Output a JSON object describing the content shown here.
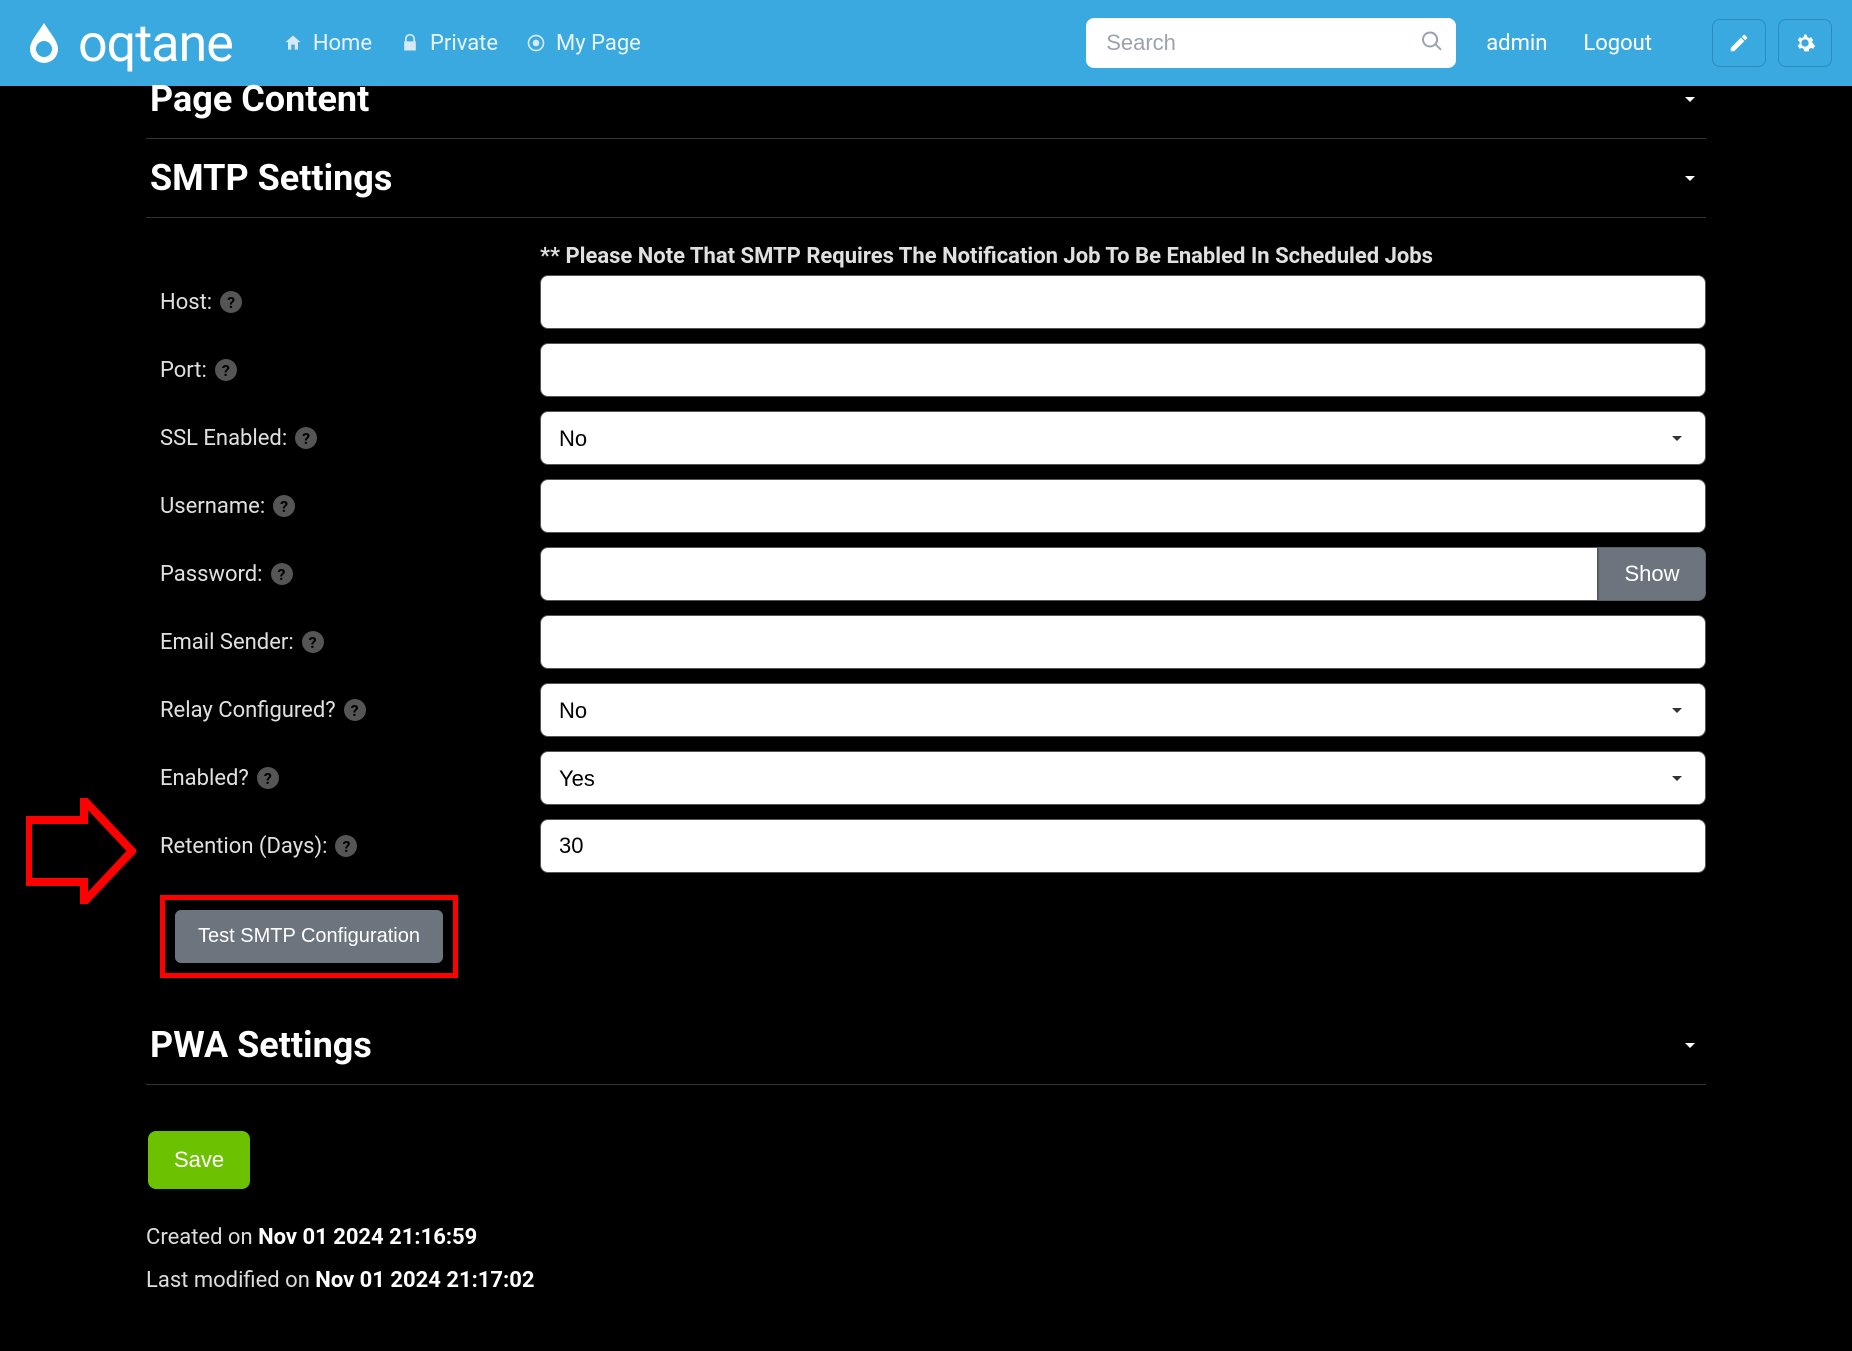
{
  "header": {
    "logo_text": "oqtane",
    "nav": [
      {
        "label": "Home",
        "icon": "home"
      },
      {
        "label": "Private",
        "icon": "lock"
      },
      {
        "label": "My Page",
        "icon": "target"
      }
    ],
    "search_placeholder": "Search",
    "user_link": "admin",
    "logout_link": "Logout"
  },
  "sections": {
    "page_content_title": "Page Content",
    "smtp_title": "SMTP Settings",
    "smtp_note": "** Please Note That SMTP Requires The Notification Job To Be Enabled In Scheduled Jobs",
    "pwa_title": "PWA Settings"
  },
  "smtp": {
    "host_label": "Host:",
    "host_value": "",
    "port_label": "Port:",
    "port_value": "",
    "ssl_label": "SSL Enabled:",
    "ssl_value": "No",
    "username_label": "Username:",
    "username_value": "",
    "password_label": "Password:",
    "password_value": "",
    "show_btn": "Show",
    "email_sender_label": "Email Sender:",
    "email_sender_value": "",
    "relay_label": "Relay Configured?",
    "relay_value": "No",
    "enabled_label": "Enabled?",
    "enabled_value": "Yes",
    "retention_label": "Retention (Days):",
    "retention_value": "30",
    "test_btn": "Test SMTP Configuration"
  },
  "actions": {
    "save": "Save"
  },
  "meta": {
    "created_prefix": "Created on ",
    "created_value": "Nov 01 2024 21:16:59",
    "modified_prefix": "Last modified on ",
    "modified_value": "Nov 01 2024 21:17:02"
  }
}
